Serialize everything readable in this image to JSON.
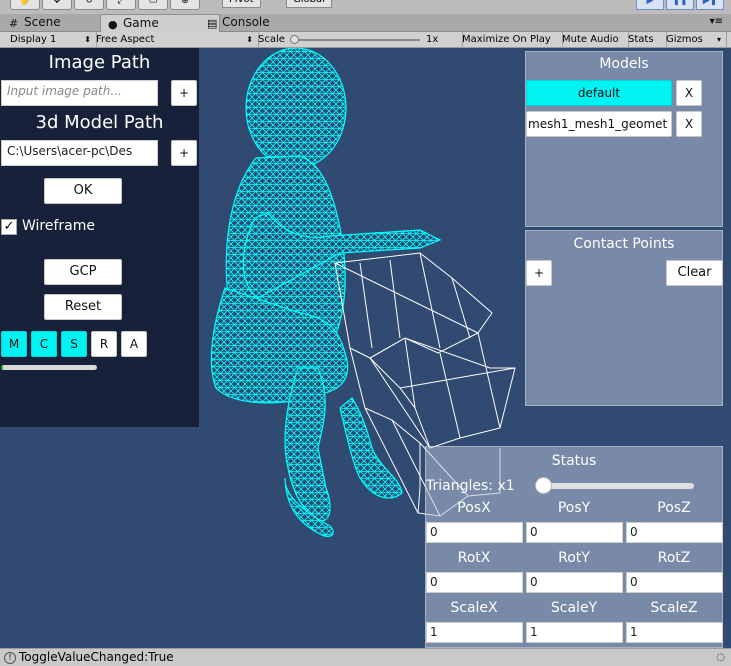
{
  "editor": {
    "toolbar": {
      "pivot_label": "Pivot",
      "global_label": "Global"
    },
    "tabs": [
      {
        "label": "Scene",
        "icon": "scene-icon"
      },
      {
        "label": "Game",
        "icon": "game-icon"
      },
      {
        "label": "Console",
        "icon": "console-icon"
      }
    ],
    "game_toolbar": {
      "display": "Display 1",
      "aspect": "Free Aspect",
      "scale_label": "Scale",
      "scale_value": "1x",
      "maximize": "Maximize On Play",
      "mute": "Mute Audio",
      "stats": "Stats",
      "gizmos": "Gizmos"
    },
    "status_message": "ToggleValueChanged:True"
  },
  "left_panel": {
    "image_path_title": "Image Path",
    "image_path_placeholder": "Input image path...",
    "image_add": "+",
    "model_path_title": "3d Model Path",
    "model_path_value": "C:\\Users\\acer-pc\\Des",
    "model_add": "+",
    "ok": "OK",
    "wireframe_label": "Wireframe",
    "wireframe_checked": true,
    "wireframe_check_glyph": "✓",
    "gcp": "GCP",
    "reset": "Reset",
    "modes": [
      {
        "label": "M",
        "active": true
      },
      {
        "label": "C",
        "active": true
      },
      {
        "label": "S",
        "active": true
      },
      {
        "label": "R",
        "active": false
      },
      {
        "label": "A",
        "active": false
      }
    ],
    "progress_fraction": 0.02,
    "colors": {
      "panel": "#17213a",
      "active_mode": "#00f2f2",
      "progress": "#17c41b"
    }
  },
  "models_panel": {
    "title": "Models",
    "items": [
      {
        "name": "default",
        "selected": true,
        "remove": "X"
      },
      {
        "name": "mesh1_mesh1_geomet",
        "selected": false,
        "remove": "X"
      }
    ]
  },
  "contact_panel": {
    "title": "Contact Points",
    "add": "+",
    "clear": "Clear"
  },
  "status_panel": {
    "title": "Status",
    "triangles_label": "Triangles: x1",
    "triangles_slider_fraction": 0.0,
    "position": {
      "labels": [
        "PosX",
        "PosY",
        "PosZ"
      ],
      "values": [
        "0",
        "0",
        "0"
      ]
    },
    "rotation": {
      "labels": [
        "RotX",
        "RotY",
        "RotZ"
      ],
      "values": [
        "0",
        "0",
        "0"
      ]
    },
    "scale": {
      "labels": [
        "ScaleX",
        "ScaleY",
        "ScaleZ"
      ],
      "values": [
        "1",
        "1",
        "1"
      ]
    }
  },
  "scene": {
    "background": "#304a72",
    "figure_color": "#00ffff",
    "object_color": "#ffffff"
  }
}
